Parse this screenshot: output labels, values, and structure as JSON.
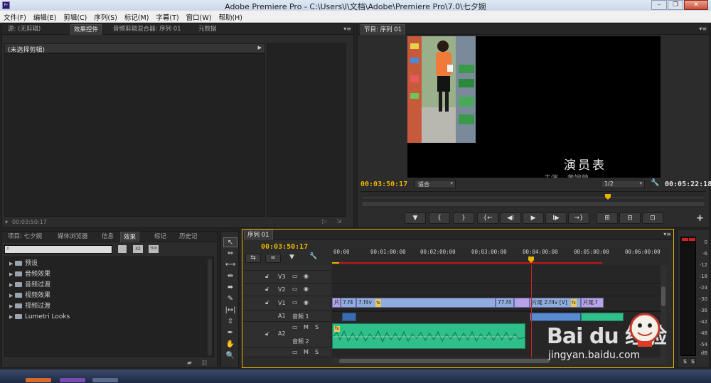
{
  "window": {
    "title": "Adobe Premiere Pro - C:\\Users\\l\\文档\\Adobe\\Premiere Pro\\7.0\\七夕婉",
    "app_icon": "Pr",
    "min": "–",
    "restore": "❐",
    "close": "✕"
  },
  "menu": [
    "文件(F)",
    "编辑(E)",
    "剪辑(C)",
    "序列(S)",
    "标记(M)",
    "字幕(T)",
    "窗口(W)",
    "帮助(H)"
  ],
  "source_panel": {
    "tabs": [
      "源: (无剪辑)",
      "效果控件",
      "音频剪辑混合器: 序列 01",
      "元数据"
    ],
    "active_tab": 1,
    "no_clip_label": "(未选择剪辑)",
    "timecode": "00:03:50:17"
  },
  "program_monitor": {
    "tab": "节目: 序列 01",
    "overlay_title": "演员表",
    "overlay_sub": "主演    黄婉莹",
    "timecode_left": "00:03:50:17",
    "fit_label": "适合",
    "resolution": "1/2",
    "timecode_right": "00:05:22:18",
    "controls": [
      "▼",
      "{",
      "}",
      "{←",
      "◀I",
      "▶",
      "I▶",
      "→}",
      "⊞",
      "⊟",
      "⊡"
    ],
    "add": "+"
  },
  "project_panel": {
    "tabs": [
      "项目: 七夕婉",
      "媒体浏览器",
      "信息",
      "效果",
      "标记",
      "历史记"
    ],
    "active_tab": 3,
    "items": [
      "预设",
      "音频效果",
      "音频过渡",
      "视频效果",
      "视频过渡",
      "Lumetri Looks"
    ],
    "bins": [
      "32",
      "YUV"
    ]
  },
  "tools": [
    "↖",
    "⇔",
    "⟷",
    "⇹",
    "⬌",
    "✎",
    "|↔|",
    "⇳",
    "✒",
    "✋",
    "🔍"
  ],
  "timeline": {
    "tab": "序列 01",
    "timecode": "00:03:50:17",
    "ruler": [
      "00:00",
      "00:01:00:00",
      "00:02:00:00",
      "00:03:00:00",
      "00:04:00:00",
      "00:05:00:00",
      "00:06:00:00"
    ],
    "tracks": {
      "v3": "V3",
      "v2": "V2",
      "v1": "V1",
      "a1_label": "A1",
      "audio1": "音频 1",
      "a2": "A2",
      "audio2": "音频 2",
      "m": "M",
      "s": "S"
    },
    "clips": {
      "v1": [
        "片",
        "7.f4",
        "7.f4v",
        "fx",
        "77.f4",
        "片尾 2.f4v [V]",
        "fx",
        "片尾.f"
      ]
    },
    "fx": "fx"
  },
  "meter": {
    "scale": [
      "0",
      "-6",
      "-12",
      "-18",
      "-24",
      "-30",
      "-36",
      "-42",
      "-48",
      "-54",
      "dB"
    ],
    "solo": [
      "S",
      "S"
    ]
  },
  "watermark": {
    "brand": "Bai du 经验",
    "url": "jingyan.baidu.com"
  },
  "colors": {
    "accent": "#e8b400",
    "playhead": "#d02020",
    "video_clip": "#8faede",
    "audio_clip": "#2fbf8a"
  }
}
